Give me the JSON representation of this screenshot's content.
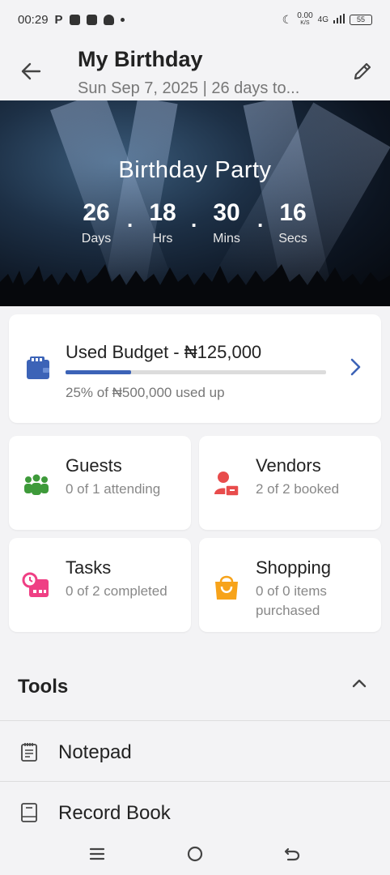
{
  "status_bar": {
    "time": "00:29",
    "net_speed": "0.00",
    "net_unit": "K/S",
    "network": "4G",
    "battery": "55"
  },
  "header": {
    "title": "My Birthday",
    "subtitle": "Sun Sep 7, 2025  |  26 days to..."
  },
  "hero": {
    "event_name": "Birthday Party",
    "countdown": [
      {
        "value": "26",
        "label": "Days"
      },
      {
        "value": "18",
        "label": "Hrs"
      },
      {
        "value": "30",
        "label": "Mins"
      },
      {
        "value": "16",
        "label": "Secs"
      }
    ]
  },
  "budget": {
    "title": "Used Budget - ₦125,000",
    "subtitle": "25% of ₦500,000 used up",
    "progress_fraction": 0.25,
    "accent_color": "#3c63b7"
  },
  "tiles": [
    {
      "name": "Guests",
      "sub": "0 of 1 attending",
      "icon": "guests-icon",
      "color": "#3e9a3a"
    },
    {
      "name": "Vendors",
      "sub": "2 of 2 booked",
      "icon": "vendors-icon",
      "color": "#e84c4c"
    },
    {
      "name": "Tasks",
      "sub": "0 of 2 completed",
      "icon": "tasks-icon",
      "color": "#ef3f84"
    },
    {
      "name": "Shopping",
      "sub": "0 of 0 items purchased",
      "icon": "shopping-bag-icon",
      "color": "#f7a31a"
    }
  ],
  "tools": {
    "title": "Tools",
    "items": [
      {
        "label": "Notepad",
        "icon": "notepad-icon"
      },
      {
        "label": "Record Book",
        "icon": "record-book-icon"
      }
    ]
  }
}
